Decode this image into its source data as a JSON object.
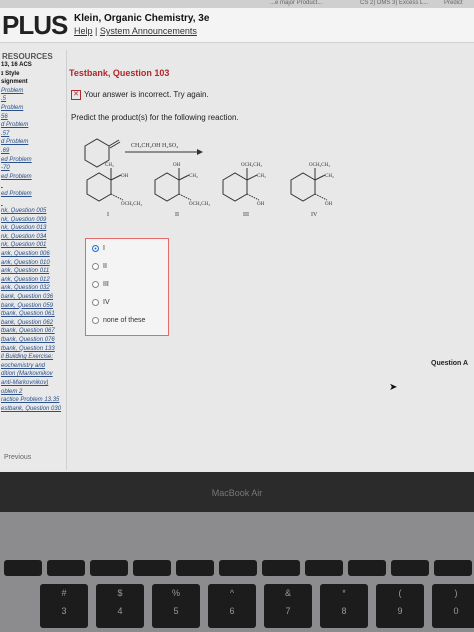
{
  "browser_tabs": [
    {
      "label": "...e major Product..."
    },
    {
      "label": "CS 2) DMS 3) Excess L..."
    },
    {
      "label": "Predict"
    }
  ],
  "header": {
    "logo": "PLUS",
    "course_title": "Klein, Organic Chemistry, 3e",
    "help_link": "Help",
    "separator": " | ",
    "announcements_link": "System Announcements"
  },
  "sidebar": {
    "title": "RESOURCES",
    "items": [
      {
        "label": "13, 16 ACS",
        "bold": true
      },
      {
        "label": "ɪ Style",
        "bold": true
      },
      {
        "label": "signment",
        "bold": true
      },
      {
        "label": "Problem"
      },
      {
        "label": ".5"
      },
      {
        "label": "Problem"
      },
      {
        "label": "56"
      },
      {
        "label": "d Problem"
      },
      {
        "label": ".57"
      },
      {
        "label": "d Problem"
      },
      {
        "label": ".69"
      },
      {
        "label": "ed Problem"
      },
      {
        "label": "-70"
      },
      {
        "label": "ed Problem"
      },
      {
        "label": ""
      },
      {
        "label": "ed Problem"
      },
      {
        "label": ""
      },
      {
        "label": "nk, Question 005"
      },
      {
        "label": "nk, Question 009"
      },
      {
        "label": "nk, Question 013"
      },
      {
        "label": "nk, Question 034"
      },
      {
        "label": "nk, Question 001"
      },
      {
        "label": "ank, Question 006"
      },
      {
        "label": "ank, Question 010"
      },
      {
        "label": "ank, Question 011"
      },
      {
        "label": "ank, Question 012"
      },
      {
        "label": "ank, Question 032"
      },
      {
        "label": "bank, Question 036"
      },
      {
        "label": "bank, Question 059"
      },
      {
        "label": "tbank, Question 061"
      },
      {
        "label": "bank, Question 062"
      },
      {
        "label": "tbank, Question 067"
      },
      {
        "label": "tbank, Question 076"
      },
      {
        "label": "tbank, Question 133"
      },
      {
        "label": "ll Building Exercise:"
      },
      {
        "label": "eochemistry and"
      },
      {
        "label": "dition (Markovnikov"
      },
      {
        "label": "anti-Markovnikov)"
      },
      {
        "label": "oblem 2"
      },
      {
        "label": "ractice Problem 13.35"
      },
      {
        "label": "estbank, Question 030"
      }
    ]
  },
  "question": {
    "title": "Testbank, Question 103",
    "feedback": "Your answer is incorrect.  Try again.",
    "prompt": "Predict the product(s) for the following reaction.",
    "reagent": "CH₃CH₂OH H₂SO₄",
    "structures": [
      {
        "numeral": "I",
        "group_top": "CH₃",
        "group_oh": "OH",
        "group_bottom": "OCH₂CH₃"
      },
      {
        "numeral": "II",
        "group_top": "OH",
        "group_oh": "CH₃",
        "group_bottom": "OCH₂CH₃"
      },
      {
        "numeral": "III",
        "group_top": "OCH₂CH₃",
        "group_oh": "CH₃",
        "group_bottom": "OH"
      },
      {
        "numeral": "IV",
        "group_top": "OCH₂CH₃",
        "group_oh": "CH₃",
        "group_bottom": "OH"
      }
    ],
    "choices": [
      {
        "label": "I",
        "selected": true
      },
      {
        "label": "II",
        "selected": false
      },
      {
        "label": "III",
        "selected": false
      },
      {
        "label": "IV",
        "selected": false
      },
      {
        "label": "none of these",
        "selected": false
      }
    ],
    "side_label": "Question A",
    "previous": "Previous"
  },
  "laptop": {
    "brand": "MacBook Air",
    "keys_row1": [
      "",
      "",
      "",
      "",
      "",
      "",
      "",
      "",
      "",
      "",
      ""
    ],
    "keys_row2": [
      "#",
      "$",
      "%",
      "^",
      "&",
      "*",
      "(",
      ")"
    ],
    "keys_row2_digits": [
      "3",
      "4",
      "5",
      "6",
      "7",
      "8",
      "9",
      "0"
    ]
  },
  "colors": {
    "accent_red": "#b3262b",
    "selected_blue": "#1e73c7",
    "link_blue": "#2a4f8a"
  }
}
